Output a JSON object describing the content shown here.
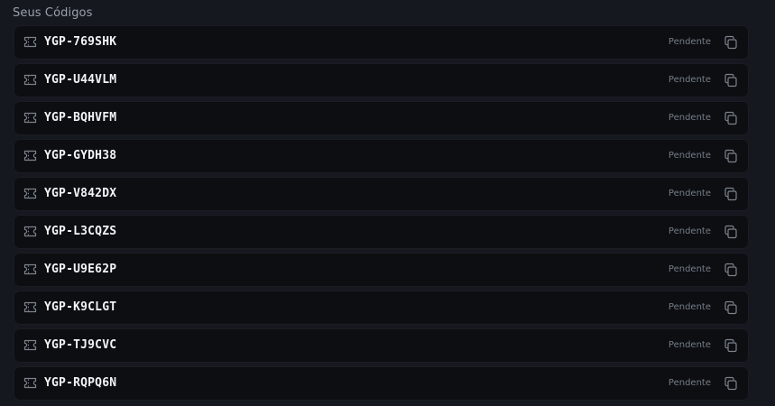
{
  "section": {
    "title": "Seus Códigos"
  },
  "codes": [
    {
      "code": "YGP-769SHK",
      "status": "Pendente",
      "icon": "ticket-icon",
      "action_icon": "copy-icon"
    },
    {
      "code": "YGP-U44VLM",
      "status": "Pendente",
      "icon": "ticket-icon",
      "action_icon": "copy-icon"
    },
    {
      "code": "YGP-BQHVFM",
      "status": "Pendente",
      "icon": "ticket-icon",
      "action_icon": "copy-icon"
    },
    {
      "code": "YGP-GYDH38",
      "status": "Pendente",
      "icon": "ticket-icon",
      "action_icon": "copy-icon"
    },
    {
      "code": "YGP-V842DX",
      "status": "Pendente",
      "icon": "ticket-icon",
      "action_icon": "copy-icon"
    },
    {
      "code": "YGP-L3CQZS",
      "status": "Pendente",
      "icon": "ticket-icon",
      "action_icon": "copy-icon"
    },
    {
      "code": "YGP-U9E62P",
      "status": "Pendente",
      "icon": "ticket-icon",
      "action_icon": "copy-icon"
    },
    {
      "code": "YGP-K9CLGT",
      "status": "Pendente",
      "icon": "ticket-icon",
      "action_icon": "copy-icon"
    },
    {
      "code": "YGP-TJ9CVC",
      "status": "Pendente",
      "icon": "ticket-icon",
      "action_icon": "copy-icon"
    },
    {
      "code": "YGP-RQPQ6N",
      "status": "Pendente",
      "icon": "ticket-icon",
      "action_icon": "copy-icon"
    }
  ],
  "colors": {
    "page_background": "#15181e",
    "row_background": "#0c0e12",
    "code_text": "#f2f4f6",
    "status_text": "#767d88",
    "icon": "#7c838d"
  }
}
